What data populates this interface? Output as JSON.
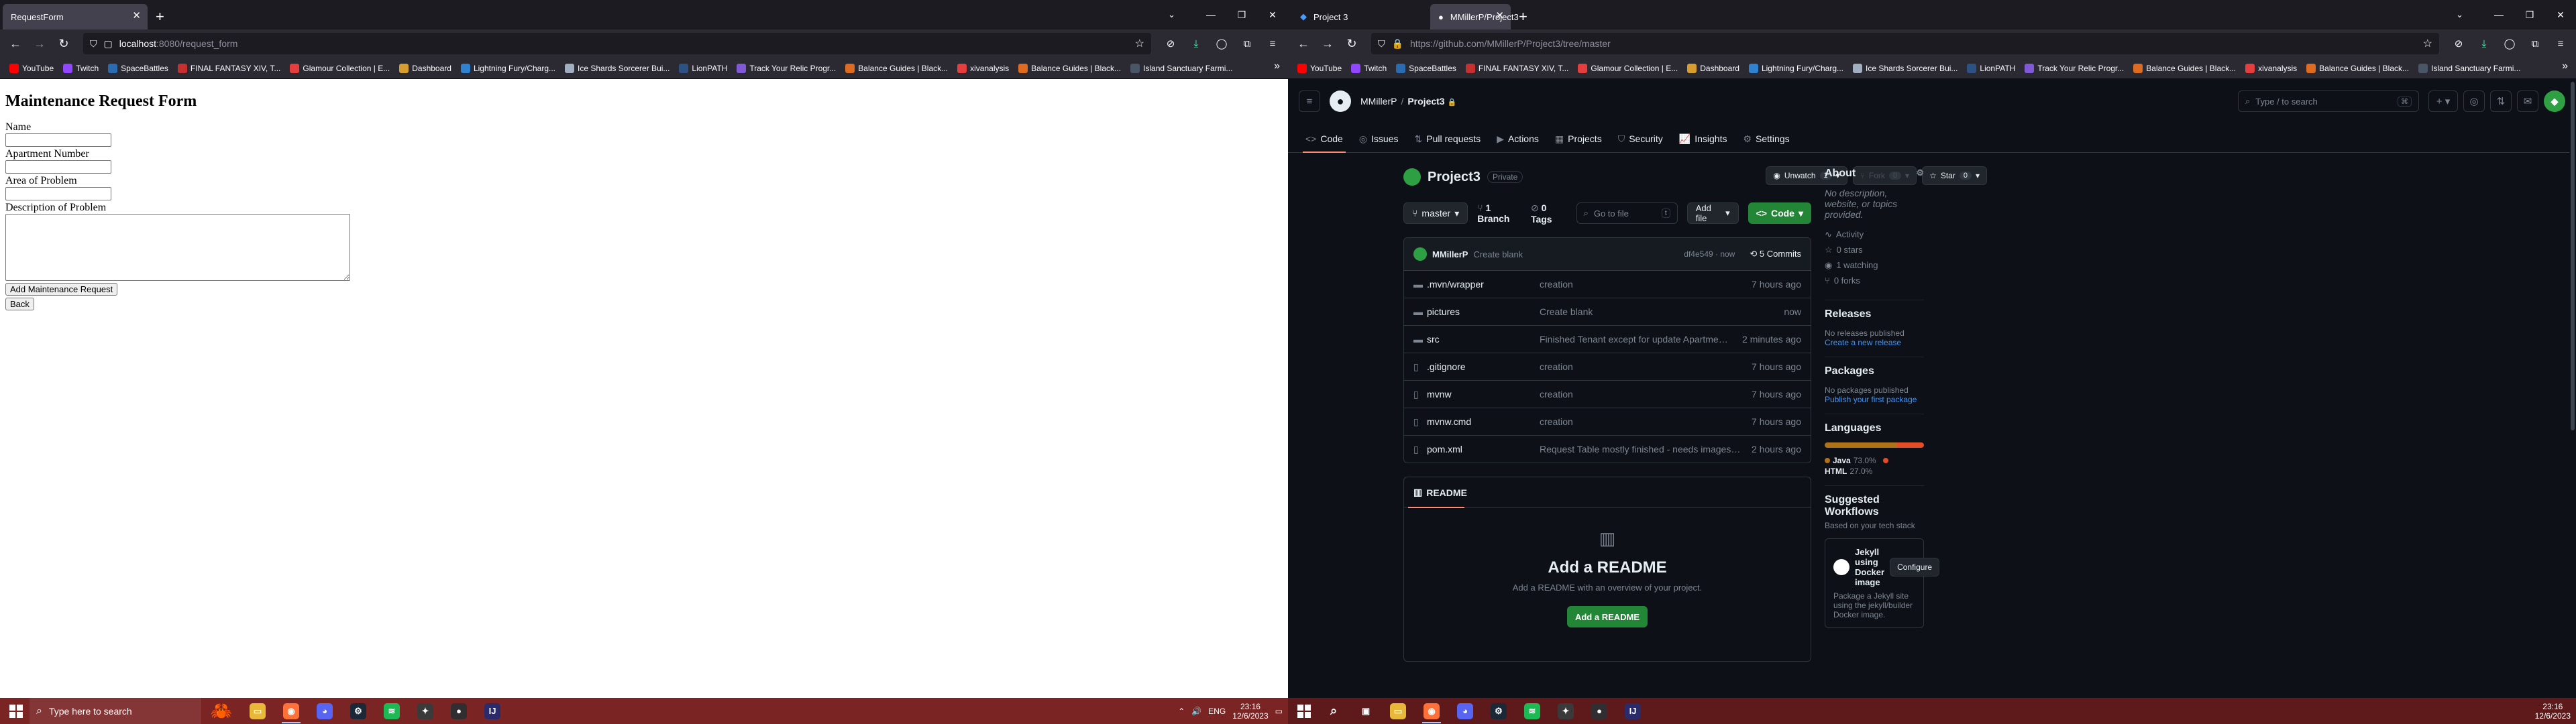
{
  "left": {
    "tabs": [
      {
        "title": "RequestForm",
        "active": true
      }
    ],
    "url": {
      "host": "localhost",
      "path": ":8080/request_form"
    },
    "form": {
      "heading": "Maintenance Request Form",
      "name_label": "Name",
      "apt_label": "Apartment Number",
      "area_label": "Area of Problem",
      "desc_label": "Description of Problem",
      "submit_label": "Add Maintenance Request",
      "back_label": "Back"
    },
    "taskbar": {
      "search_placeholder": "Type here to search",
      "lang": "ENG",
      "time": "23:16",
      "date": "12/6/2023"
    }
  },
  "bookmarks": [
    {
      "label": "YouTube",
      "color": "#ff0000"
    },
    {
      "label": "Twitch",
      "color": "#9146ff"
    },
    {
      "label": "SpaceBattles",
      "color": "#2b6cb0"
    },
    {
      "label": "FINAL FANTASY XIV, T...",
      "color": "#c53030"
    },
    {
      "label": "Glamour Collection | E...",
      "color": "#e53e3e"
    },
    {
      "label": "Dashboard",
      "color": "#d69e2e"
    },
    {
      "label": "Lightning Fury/Charg...",
      "color": "#3182ce"
    },
    {
      "label": "Ice Shards Sorcerer Bui...",
      "color": "#a0aec0"
    },
    {
      "label": "LionPATH",
      "color": "#2c5282"
    },
    {
      "label": "Track Your Relic Progr...",
      "color": "#805ad5"
    },
    {
      "label": "Balance Guides | Black...",
      "color": "#dd6b20"
    },
    {
      "label": "xivanalysis",
      "color": "#e53e3e"
    },
    {
      "label": "Balance Guides | Black...",
      "color": "#dd6b20"
    },
    {
      "label": "Island Sanctuary Farmi...",
      "color": "#4a5568"
    }
  ],
  "right": {
    "tabs": [
      {
        "title": "Project 3",
        "active": false
      },
      {
        "title": "MMillerP/Project3",
        "active": true
      }
    ],
    "url": "https://github.com/MMillerP/Project3/tree/master",
    "gh": {
      "owner": "MMillerP",
      "repo": "Project3",
      "search_placeholder": "Type / to search",
      "nav": [
        {
          "label": "Code",
          "icon": "<>"
        },
        {
          "label": "Issues",
          "icon": "◎"
        },
        {
          "label": "Pull requests",
          "icon": "⇅"
        },
        {
          "label": "Actions",
          "icon": "▶"
        },
        {
          "label": "Projects",
          "icon": "▦"
        },
        {
          "label": "Security",
          "icon": "⛉"
        },
        {
          "label": "Insights",
          "icon": "📈"
        },
        {
          "label": "Settings",
          "icon": "⚙"
        }
      ],
      "visibility": "Private",
      "unwatch": "Unwatch",
      "unwatch_count": "1",
      "fork": "Fork",
      "fork_count": "0",
      "star": "Star",
      "star_count": "0",
      "branch": "master",
      "branches": "1 Branch",
      "tags": "0 Tags",
      "goto_placeholder": "Go to file",
      "add_file": "Add file",
      "code_btn": "Code",
      "commit": {
        "author": "MMillerP",
        "message": "Create blank",
        "hash": "df4e549 · now",
        "count": "5 Commits"
      },
      "files": [
        {
          "type": "dir",
          "name": ".mvn/wrapper",
          "msg": "creation",
          "time": "7 hours ago"
        },
        {
          "type": "dir",
          "name": "pictures",
          "msg": "Create blank",
          "time": "now"
        },
        {
          "type": "dir",
          "name": "src",
          "msg": "Finished Tenant except for update Apartment - will not conn...",
          "time": "2 minutes ago"
        },
        {
          "type": "file",
          "name": ".gitignore",
          "msg": "creation",
          "time": "7 hours ago"
        },
        {
          "type": "file",
          "name": "mvnw",
          "msg": "creation",
          "time": "7 hours ago"
        },
        {
          "type": "file",
          "name": "mvnw.cmd",
          "msg": "creation",
          "time": "7 hours ago"
        },
        {
          "type": "file",
          "name": "pom.xml",
          "msg": "Request Table mostly finished - needs images,status update f...",
          "time": "2 hours ago"
        }
      ],
      "readme": {
        "tab": "README",
        "title": "Add a README",
        "desc": "Add a README with an overview of your project.",
        "button": "Add a README"
      },
      "about": {
        "title": "About",
        "desc": "No description, website, or topics provided.",
        "activity": "Activity",
        "stars": "0 stars",
        "watching": "1 watching",
        "forks": "0 forks"
      },
      "releases": {
        "title": "Releases",
        "none": "No releases published",
        "link": "Create a new release"
      },
      "packages": {
        "title": "Packages",
        "none": "No packages published",
        "link": "Publish your first package"
      },
      "languages": {
        "title": "Languages",
        "items": [
          {
            "name": "Java",
            "pct": "73.0%",
            "value": 73.0,
            "color": "#b07219"
          },
          {
            "name": "HTML",
            "pct": "27.0%",
            "value": 27.0,
            "color": "#e34c26"
          }
        ]
      },
      "workflows": {
        "title": "Suggested Workflows",
        "subtitle": "Based on your tech stack",
        "name": "Jekyll using Docker image",
        "configure": "Configure",
        "desc": "Package a Jekyll site using the jekyll/builder Docker image."
      }
    },
    "taskbar": {
      "time": "23:16",
      "date": "12/6/2023"
    }
  },
  "taskbar_apps": [
    {
      "name": "file-explorer-icon",
      "color": "#e8b839",
      "glyph": "▭"
    },
    {
      "name": "firefox-icon",
      "color": "#ff7139",
      "glyph": "◉"
    },
    {
      "name": "discord-icon",
      "color": "#5865f2",
      "glyph": "◕"
    },
    {
      "name": "steam-icon",
      "color": "#1b2838",
      "glyph": "⚙"
    },
    {
      "name": "spotify-icon",
      "color": "#1db954",
      "glyph": "≋"
    },
    {
      "name": "settings-app-icon",
      "color": "#3a3a3a",
      "glyph": "✦"
    },
    {
      "name": "obs-icon",
      "color": "#302e31",
      "glyph": "●"
    },
    {
      "name": "intellij-icon",
      "color": "#2b2b6b",
      "glyph": "IJ"
    }
  ]
}
